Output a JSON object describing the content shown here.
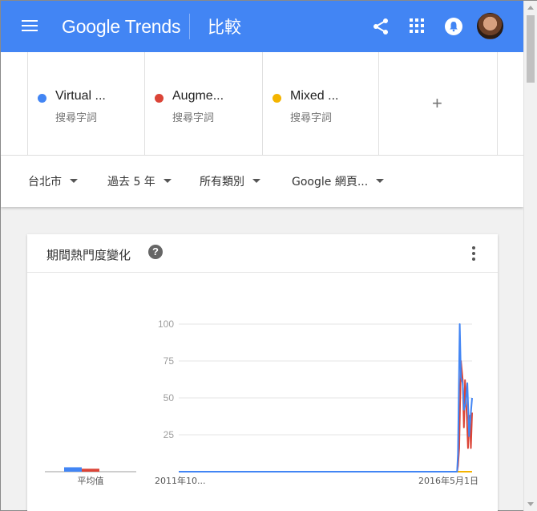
{
  "header": {
    "menu_icon": "menu-icon",
    "logo_google": "Google",
    "logo_trends": "Trends",
    "page_title": "比較",
    "share_icon": "share-icon",
    "apps_icon": "apps-icon",
    "notifications_icon": "notifications-icon",
    "avatar": "user-avatar"
  },
  "terms": [
    {
      "name": "Virtual ...",
      "sub": "搜尋字詞",
      "color": "#4285f4"
    },
    {
      "name": "Augme...",
      "sub": "搜尋字詞",
      "color": "#db4437"
    },
    {
      "name": "Mixed ...",
      "sub": "搜尋字詞",
      "color": "#f4b400"
    }
  ],
  "add_term_label": "+",
  "filters": {
    "region": "台北市",
    "time": "過去 5 年",
    "category": "所有類別",
    "search_type": "Google 網頁..."
  },
  "card": {
    "title": "期間熱門度變化",
    "help_label": "?"
  },
  "chart_data": {
    "type": "line",
    "ylim": [
      0,
      100
    ],
    "yticks": [
      "100",
      "75",
      "50",
      "25"
    ],
    "x_labels": [
      "2011年10...",
      "2016年5月1日"
    ],
    "average_label": "平均值",
    "average_bars": [
      {
        "name": "Virtual ...",
        "value": 3,
        "color": "#4285f4"
      },
      {
        "name": "Augme...",
        "value": 2,
        "color": "#db4437"
      },
      {
        "name": "Mixed ...",
        "value": 0,
        "color": "#f4b400"
      }
    ],
    "series": [
      {
        "name": "Virtual ...",
        "color": "#4285f4",
        "points": [
          [
            0,
            0
          ],
          [
            0.949,
            0
          ],
          [
            0.952,
            12
          ],
          [
            0.958,
            100
          ],
          [
            0.962,
            64
          ],
          [
            0.968,
            60
          ],
          [
            0.972,
            42
          ],
          [
            0.978,
            46
          ],
          [
            0.984,
            60
          ],
          [
            0.99,
            24
          ],
          [
            0.996,
            40
          ],
          [
            1.0,
            50
          ]
        ]
      },
      {
        "name": "Augme...",
        "color": "#db4437",
        "points": [
          [
            0,
            0
          ],
          [
            0.949,
            0
          ],
          [
            0.952,
            4
          ],
          [
            0.956,
            16
          ],
          [
            0.962,
            75
          ],
          [
            0.968,
            62
          ],
          [
            0.972,
            30
          ],
          [
            0.976,
            62
          ],
          [
            0.982,
            38
          ],
          [
            0.986,
            16
          ],
          [
            0.992,
            38
          ],
          [
            0.996,
            16
          ],
          [
            1.0,
            40
          ]
        ]
      },
      {
        "name": "Mixed ...",
        "color": "#f4b400",
        "points": [
          [
            0,
            0
          ],
          [
            1.0,
            0
          ]
        ]
      }
    ]
  }
}
